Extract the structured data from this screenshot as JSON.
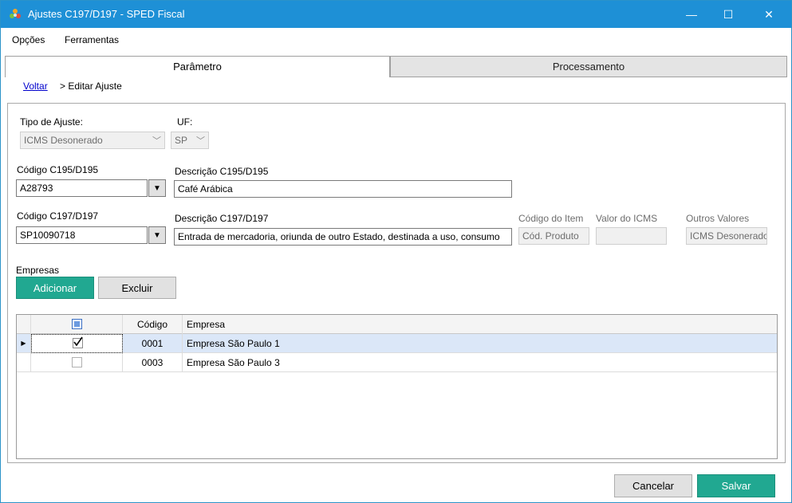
{
  "window": {
    "title": "Ajustes C197/D197 - SPED Fiscal",
    "minimize_icon": "minimize-icon",
    "maximize_icon": "maximize-icon",
    "close_icon": "close-icon"
  },
  "menu": {
    "items": [
      "Opções",
      "Ferramentas"
    ]
  },
  "tabs": [
    {
      "label": "Parâmetro",
      "active": true
    },
    {
      "label": "Processamento",
      "active": false
    }
  ],
  "breadcrumb": {
    "back_link": "Voltar",
    "current": "> Editar Ajuste"
  },
  "form": {
    "tipo_ajuste_label": "Tipo de Ajuste:",
    "tipo_ajuste_value": "ICMS Desonerado",
    "uf_label": "UF:",
    "uf_value": "SP",
    "codigo_c195_label": "Código C195/D195",
    "codigo_c195_value": "A28793",
    "descricao_c195_label": "Descrição C195/D195",
    "descricao_c195_value": "Café Arábica",
    "codigo_c197_label": "Código C197/D197",
    "codigo_c197_value": "SP10090718",
    "descricao_c197_label": "Descrição C197/D197",
    "descricao_c197_value": "Entrada de mercadoria, oriunda de outro Estado, destinada a uso, consumo",
    "codigo_item_label": "Código do Item",
    "codigo_item_value": "Cód. Produto",
    "valor_icms_label": "Valor do ICMS",
    "valor_icms_value": "",
    "outros_valores_label": "Outros Valores",
    "outros_valores_value": "ICMS Desonerado",
    "dropdown_glyph": "▼"
  },
  "empresas": {
    "section_label": "Empresas",
    "add_button": "Adicionar",
    "delete_button": "Excluir",
    "columns": [
      "Código",
      "Empresa"
    ],
    "rows": [
      {
        "codigo": "0001",
        "empresa": "Empresa São Paulo  1",
        "checked": true,
        "selected": true
      },
      {
        "codigo": "0003",
        "empresa": "Empresa São Paulo 3",
        "checked": false,
        "selected": false
      }
    ]
  },
  "footer": {
    "cancel_button": "Cancelar",
    "save_button": "Salvar"
  },
  "colors": {
    "titlebar": "#1e90d6",
    "accent_teal": "#21a891",
    "selected_row": "#dbe7f8"
  }
}
